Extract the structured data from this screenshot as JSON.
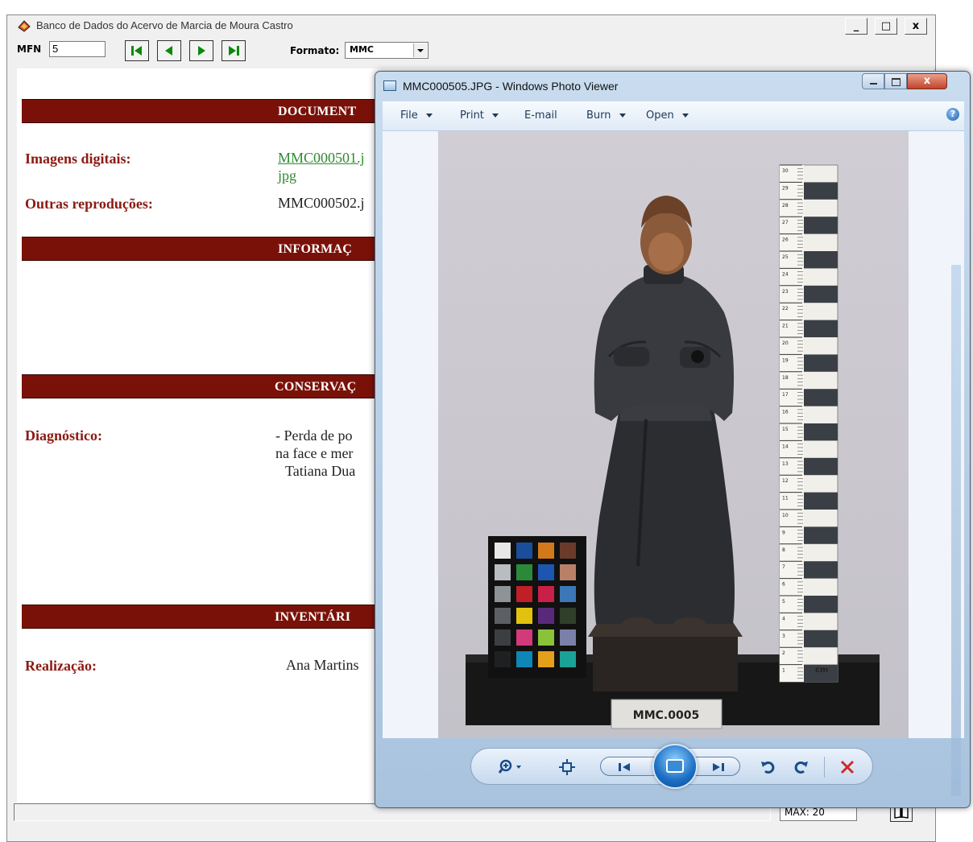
{
  "main_window": {
    "title": "Banco de Dados do Acervo de Marcia de Moura Castro",
    "controls": {
      "minimize": "_",
      "maximize": "□",
      "close": "x"
    }
  },
  "toolbar": {
    "mfn_label": "MFN",
    "mfn_value": "5",
    "format_label": "Formato:",
    "format_value": "MMC"
  },
  "record": {
    "sections": {
      "documentacao": "DOCUMENT",
      "informacao": "INFORMAÇ",
      "conservacao": "CONSERVAÇ",
      "inventario": "INVENTÁRI"
    },
    "fields": {
      "imagens_digitais": {
        "label": "Imagens digitais:",
        "value_line1": "MMC000501.j",
        "value_line2": "jpg"
      },
      "outras_reproducoes": {
        "label": "Outras reproduções:",
        "value": "MMC000502.j"
      },
      "diagnostico": {
        "label": "Diagnóstico:",
        "line1": "- Perda de po",
        "line2": "na face e mer",
        "line3": "Tatiana Dua"
      },
      "realizacao": {
        "label": "Realização:",
        "value": "Ana Martins"
      }
    }
  },
  "status": {
    "max_text": "MAX: 20"
  },
  "viewer": {
    "title": "MMC000505.JPG - Windows Photo Viewer",
    "menu": [
      "File",
      "Print",
      "E-mail",
      "Burn",
      "Open"
    ],
    "help": "?",
    "photo": {
      "label_plate": "MMC.0005",
      "ruler_unit": "cm",
      "ruler_numbers": [
        "30",
        "29",
        "28",
        "27",
        "26",
        "25",
        "24",
        "23",
        "22",
        "21",
        "20",
        "19",
        "18",
        "17",
        "16",
        "15",
        "14",
        "13",
        "12",
        "11",
        "10",
        "9",
        "8",
        "7",
        "6",
        "5",
        "4",
        "3",
        "2",
        "1"
      ],
      "color_patches": [
        "#e8e8e6",
        "#1b4e9a",
        "#d27a1a",
        "#6b3a2a",
        "#b9bdc0",
        "#2a8a3a",
        "#1c56b0",
        "#b98068",
        "#8d9396",
        "#c01f26",
        "#c82046",
        "#3c77b8",
        "#5c6064",
        "#e2c20e",
        "#5a2a7a",
        "#2f3f2a",
        "#3c3f42",
        "#d23a7a",
        "#8ac23a",
        "#7a80a8",
        "#1e2022",
        "#0e86b6",
        "#e5a01a",
        "#1aa296"
      ],
      "icons": [
        "statue",
        "color-checker",
        "measuring-ruler"
      ]
    },
    "colors": {
      "titlebar": "#c9dcef",
      "close": "#c2432a"
    }
  },
  "colors": {
    "section_band": "#7a1108",
    "label_text": "#8b1a12",
    "link_text": "#2e8b2e"
  }
}
